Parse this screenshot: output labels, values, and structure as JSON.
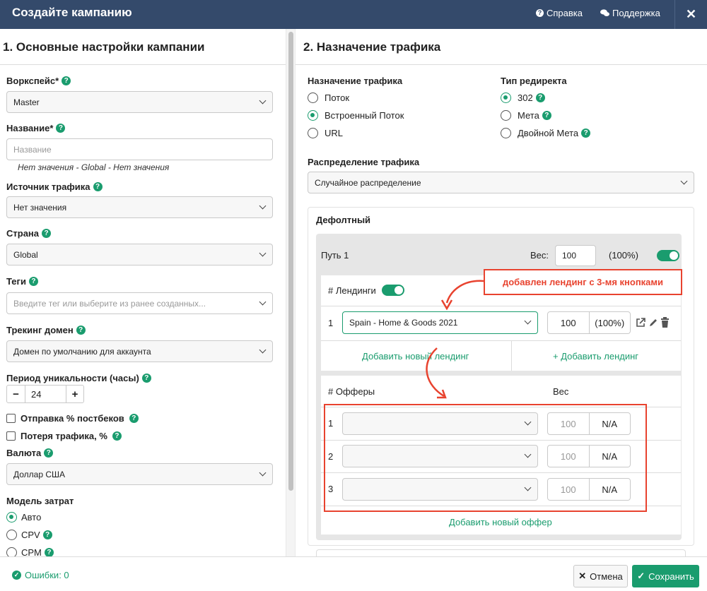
{
  "header": {
    "title": "Создайте кампанию",
    "help_label": "Справка",
    "support_label": "Поддержка",
    "close_label": "✕"
  },
  "left": {
    "section_title": "1. Основные настройки кампании",
    "workspace_label": "Ворк­спейс*",
    "workspace_value": "Master",
    "name_label": "Название*",
    "name_placeholder": "Название",
    "name_hint": "Нет значения - Global - Нет значения",
    "source_label": "Источник трафика",
    "source_value": "Нет значения",
    "country_label": "Страна",
    "country_value": "Global",
    "tags_label": "Теги",
    "tags_placeholder": "Введите тег или выберите из ранее созданных...",
    "tracking_label": "Трекинг домен",
    "tracking_value": "Домен по умолчанию для аккаунта",
    "uniq_label": "Период уникальности (часы)",
    "uniq_minus": "−",
    "uniq_value": "24",
    "uniq_plus": "+",
    "postback_label": "Отправка % постбеков",
    "loss_label": "Потеря трафика, %",
    "currency_label": "Валюта",
    "currency_value": "Доллар США",
    "cost_label": "Модель затрат",
    "cost_options": [
      "Авто",
      "CPV",
      "CPM"
    ]
  },
  "right": {
    "section_title": "2. Назначение трафика",
    "dest_label": "Назначение трафика",
    "dest_options": [
      "Поток",
      "Встроенный Поток",
      "URL"
    ],
    "redirect_label": "Тип редиректа",
    "redirect_options": [
      "302",
      "Мета",
      "Двойной Мета"
    ],
    "distribution_label": "Распределение трафика",
    "distribution_value": "Случайное распределение",
    "default_label": "Дефолтный",
    "path_label": "Путь 1",
    "weight_label": "Вес:",
    "path_weight": "100",
    "path_pct": "(100%)",
    "landers_label": "# Лендинги",
    "lander_index": "1",
    "lander_value": "Spain - Home & Goods 2021",
    "lander_weight": "100",
    "lander_pct": "(100%)",
    "add_new_lander": "Добавить новый лендинг",
    "add_lander": "+ Добавить лендинг",
    "offers_label": "# Офферы",
    "offers_weight_label": "Вес",
    "offers": [
      {
        "index": "1",
        "weight": "100",
        "pct": "N/A"
      },
      {
        "index": "2",
        "weight": "100",
        "pct": "N/A"
      },
      {
        "index": "3",
        "weight": "100",
        "pct": "N/A"
      }
    ],
    "add_offer": "Добавить новый оффер",
    "annotation": "добавлен лендинг с 3-мя кнопками"
  },
  "footer": {
    "errors_label": "Ошибки: 0",
    "cancel_label": "Отмена",
    "save_label": "Сохранить"
  },
  "colors": {
    "header_bg": "#344a6b",
    "accent": "#1a9c6e",
    "annotation": "#e8432f"
  }
}
